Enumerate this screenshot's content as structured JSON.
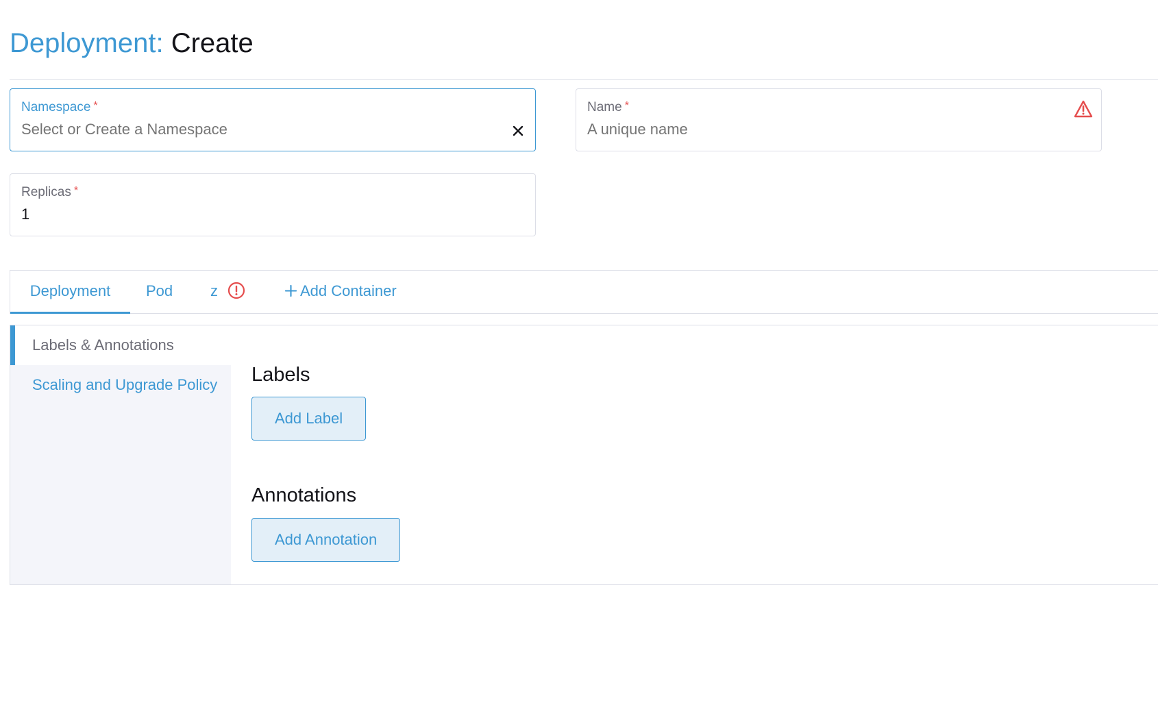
{
  "header": {
    "resource_type": "Deployment:",
    "mode": "Create"
  },
  "fields": {
    "namespace": {
      "label": "Namespace",
      "required_mark": "*",
      "placeholder": "Select or Create a Namespace",
      "value": ""
    },
    "name": {
      "label": "Name",
      "required_mark": "*",
      "placeholder": "A unique name",
      "value": "",
      "status_icon": "warning-triangle-icon"
    },
    "replicas": {
      "label": "Replicas",
      "required_mark": "*",
      "value": "1"
    }
  },
  "tabs": [
    {
      "label": "Deployment",
      "selected": true
    },
    {
      "label": "Pod",
      "selected": false
    },
    {
      "label": "z",
      "selected": false,
      "status_icon": "error-circle-icon"
    },
    {
      "label": "Add Container",
      "icon": "plus-icon"
    }
  ],
  "sidenav": [
    {
      "label": "Labels & Annotations",
      "current": true
    },
    {
      "label": "Scaling and Upgrade Policy",
      "current": false
    }
  ],
  "content": {
    "labels_title": "Labels",
    "add_label_button": "Add Label",
    "annotations_title": "Annotations",
    "add_annotation_button": "Add Annotation"
  },
  "colors": {
    "accent": "#3d98d3",
    "error": "#e54d4d",
    "border": "#dcdee7",
    "sidenav_bg": "#f4f5fa"
  }
}
